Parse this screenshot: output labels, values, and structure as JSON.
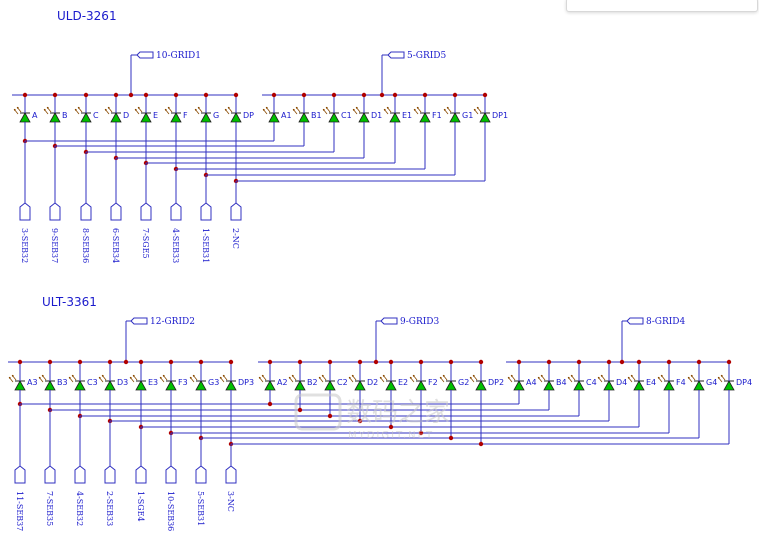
{
  "top_bar": {
    "glyphs": "│ ▪ │ ▪ │ ▪ │ ▪"
  },
  "watermark": {
    "main": "数码之家",
    "sub": "MYDIGIT.NET"
  },
  "colors": {
    "wire": "#3030c0",
    "node": "#b00000",
    "led_fill": "#00c000",
    "label": "#1a1acc"
  },
  "components": [
    {
      "title": "ULD-3261",
      "grids": [
        {
          "label": "10-GRID1",
          "segs": [
            "A",
            "B",
            "C",
            "D",
            "E",
            "F",
            "G",
            "DP"
          ]
        },
        {
          "label": "5-GRID5",
          "segs": [
            "A1",
            "B1",
            "C1",
            "D1",
            "E1",
            "F1",
            "G1",
            "DP1"
          ]
        }
      ],
      "pins": [
        "3-SEB32",
        "9-SEB37",
        "8-SEB36",
        "6-SEB34",
        "7-SGE5",
        "4-SEB33",
        "1-SEB31",
        "2-NC"
      ]
    },
    {
      "title": "ULT-3361",
      "grids": [
        {
          "label": "12-GRID2",
          "segs": [
            "A3",
            "B3",
            "C3",
            "D3",
            "E3",
            "F3",
            "G3",
            "DP3"
          ]
        },
        {
          "label": "9-GRID3",
          "segs": [
            "A2",
            "B2",
            "C2",
            "D2",
            "E2",
            "F2",
            "G2",
            "DP2"
          ]
        },
        {
          "label": "8-GRID4",
          "segs": [
            "A4",
            "B4",
            "C4",
            "D4",
            "E4",
            "F4",
            "G4",
            "DP4"
          ]
        }
      ],
      "pins": [
        "11-SEB37",
        "7-SEB35",
        "4-SEB32",
        "2-SEB33",
        "1-SGE4",
        "10-SEB36",
        "5-SEB31",
        "3-NC"
      ]
    }
  ]
}
